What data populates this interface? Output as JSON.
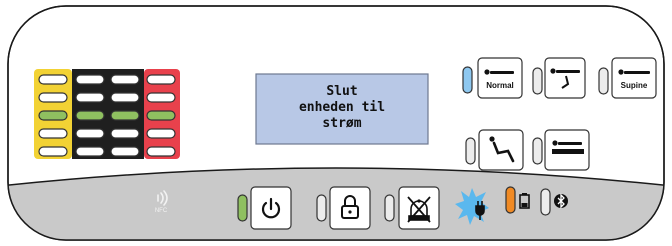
{
  "display": {
    "lines": [
      "Slut",
      "enheden til",
      "strøm"
    ]
  },
  "mode_buttons": {
    "normal_label": "Normal",
    "supine_label": "Supine"
  },
  "nfc": {
    "label": "NFC"
  },
  "leds": {
    "normal": "active",
    "power": "active",
    "battery": "warning",
    "charge_plug": "flashing"
  },
  "colors": {
    "led_off": "#ececec",
    "led_green": "#8fc060",
    "led_blue": "#8ec8f0",
    "led_orange": "#f08a24",
    "bar_yellow": "#f2d234",
    "bar_black": "#1f1f1f",
    "bar_red": "#e8414c",
    "lcd_bg": "#b8c8e6",
    "footer_gray": "#c9c9c9",
    "burst_blue": "#5ab8ee"
  },
  "icons": {
    "nfc": "nfc-icon",
    "power": "power-icon",
    "lock": "lock-icon",
    "alarm_mute": "alarm-mute-icon",
    "charge_plug": "plug-charge-icon",
    "battery": "battery-icon",
    "bluetooth": "bluetooth-icon"
  }
}
